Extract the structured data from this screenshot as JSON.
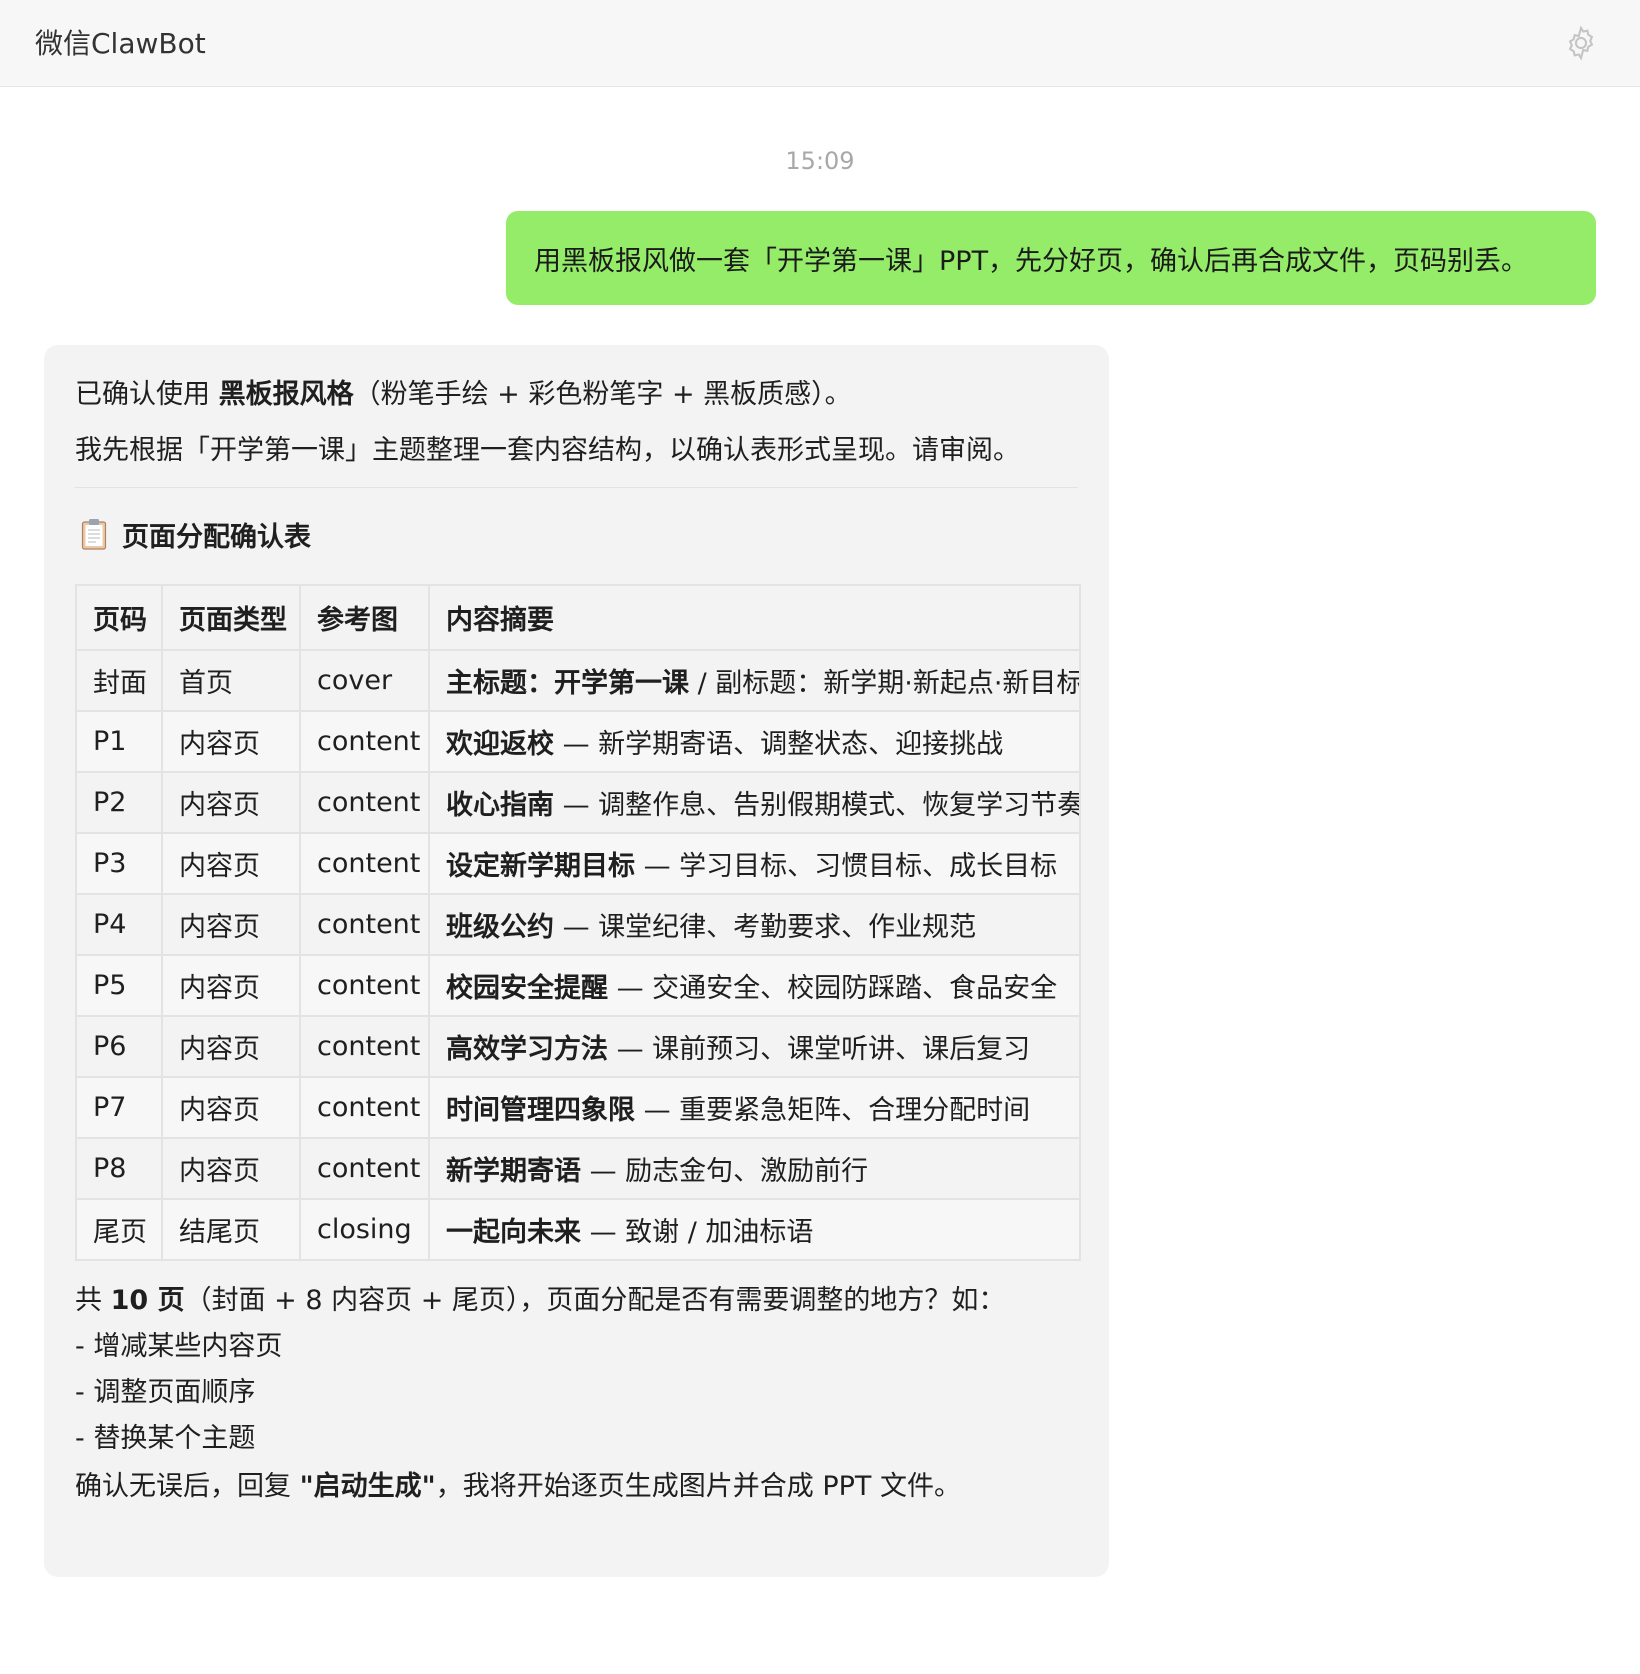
{
  "header": {
    "title": "微信ClawBot",
    "settings_icon": "gear-icon"
  },
  "chat": {
    "timestamp": "15:09",
    "user_message": "用黑板报风做一套「开学第一课」PPT，先分好页，确认后再合成文件，页码别丢。",
    "bot_reply": {
      "intro_prefix": "已确认使用 ",
      "intro_bold": "黑板报风格",
      "intro_suffix": "（粉笔手绘 + 彩色粉笔字 + 黑板质感）。",
      "intro_line2": "我先根据「开学第一课」主题整理一套内容结构，以确认表形式呈现。请审阅。",
      "section_icon": "clipboard-icon",
      "section_title": "页面分配确认表",
      "table": {
        "headers": [
          "页码",
          "页面类型",
          "参考图",
          "内容摘要"
        ],
        "rows": [
          {
            "page": "封面",
            "type": "首页",
            "ref": "cover",
            "summary_bold": "主标题：开学第一课",
            "summary_rest": " / 副标题：新学期·新起点·新目标"
          },
          {
            "page": "P1",
            "type": "内容页",
            "ref": "content",
            "summary_bold": "欢迎返校",
            "summary_rest": " — 新学期寄语、调整状态、迎接挑战"
          },
          {
            "page": "P2",
            "type": "内容页",
            "ref": "content",
            "summary_bold": "收心指南",
            "summary_rest": " — 调整作息、告别假期模式、恢复学习节奏"
          },
          {
            "page": "P3",
            "type": "内容页",
            "ref": "content",
            "summary_bold": "设定新学期目标",
            "summary_rest": " — 学习目标、习惯目标、成长目标"
          },
          {
            "page": "P4",
            "type": "内容页",
            "ref": "content",
            "summary_bold": "班级公约",
            "summary_rest": " — 课堂纪律、考勤要求、作业规范"
          },
          {
            "page": "P5",
            "type": "内容页",
            "ref": "content",
            "summary_bold": "校园安全提醒",
            "summary_rest": " — 交通安全、校园防踩踏、食品安全"
          },
          {
            "page": "P6",
            "type": "内容页",
            "ref": "content",
            "summary_bold": "高效学习方法",
            "summary_rest": " — 课前预习、课堂听讲、课后复习"
          },
          {
            "page": "P7",
            "type": "内容页",
            "ref": "content",
            "summary_bold": "时间管理四象限",
            "summary_rest": " — 重要紧急矩阵、合理分配时间"
          },
          {
            "page": "P8",
            "type": "内容页",
            "ref": "content",
            "summary_bold": "新学期寄语",
            "summary_rest": " — 励志金句、激励前行"
          },
          {
            "page": "尾页",
            "type": "结尾页",
            "ref": "closing",
            "summary_bold": "一起向未来",
            "summary_rest": " — 致谢 / 加油标语"
          }
        ]
      },
      "total_prefix": "共 ",
      "total_bold": "10 页",
      "total_suffix": "（封面 + 8 内容页 + 尾页），页面分配是否有需要调整的地方？如：",
      "options": [
        "- 增减某些内容页",
        "- 调整页面顺序",
        "- 替换某个主题"
      ],
      "confirm_prefix": "确认无误后，回复 ",
      "confirm_bold": "\"启动生成\"",
      "confirm_suffix": "，我将开始逐页生成图片并合成 PPT 文件。"
    }
  },
  "colors": {
    "user_bubble": "#95ec69",
    "bot_bubble": "#f3f3f3",
    "header_bg": "#f7f7f7",
    "timestamp": "#a8a8a8"
  }
}
